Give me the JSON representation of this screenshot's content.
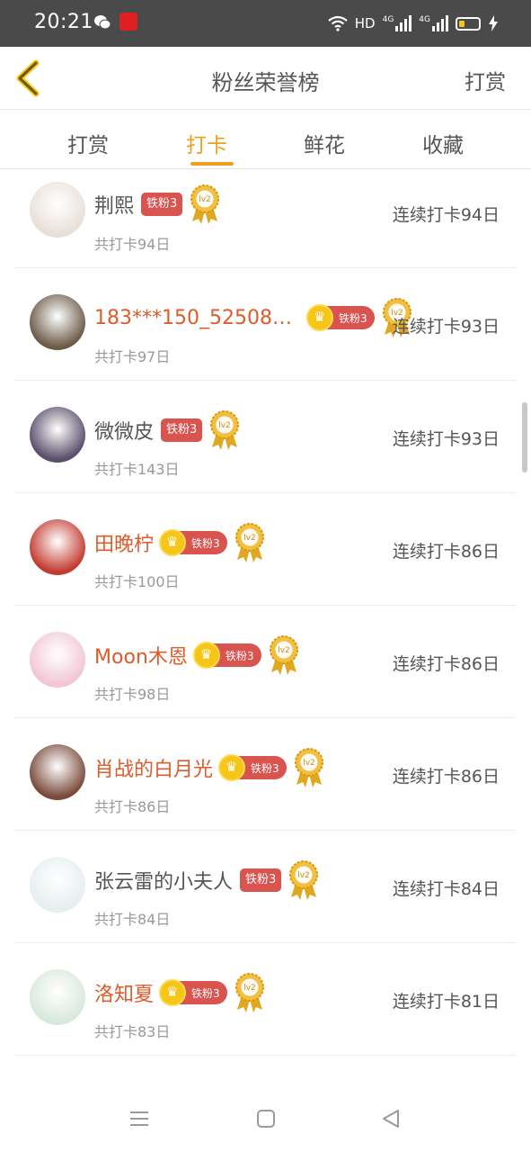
{
  "status_bar": {
    "time": "20:21",
    "indicators": [
      "wifi-icon",
      "HD",
      "4G",
      "4G",
      "battery-icon",
      "charging-icon"
    ]
  },
  "header": {
    "title": "粉丝荣誉榜",
    "action_label": "打赏"
  },
  "tabs": [
    {
      "label": "打赏",
      "active": false
    },
    {
      "label": "打卡",
      "active": true
    },
    {
      "label": "鲜花",
      "active": false
    },
    {
      "label": "收藏",
      "active": false
    }
  ],
  "fans": [
    {
      "name": "荆熙",
      "vip": false,
      "badge": "铁粉3",
      "level": "lv2",
      "total": "共打卡94日",
      "streak": "连续打卡94日",
      "avatar_color": "#e8e0d8"
    },
    {
      "name": "183***150_525085...",
      "vip": true,
      "badge": "铁粉3",
      "level": "lv2",
      "total": "共打卡97日",
      "streak": "连续打卡93日",
      "avatar_color": "#6b5a48"
    },
    {
      "name": "微微皮",
      "vip": false,
      "badge": "铁粉3",
      "level": "lv2",
      "total": "共打卡143日",
      "streak": "连续打卡93日",
      "avatar_color": "#5a4e6a"
    },
    {
      "name": "田晚柠",
      "vip": true,
      "badge": "铁粉3",
      "level": "lv2",
      "total": "共打卡100日",
      "streak": "连续打卡86日",
      "avatar_color": "#c23a30"
    },
    {
      "name": "Moon木恩",
      "vip": true,
      "badge": "铁粉3",
      "level": "lv2",
      "total": "共打卡98日",
      "streak": "连续打卡86日",
      "avatar_color": "#f2c6d4"
    },
    {
      "name": "肖战的白月光",
      "vip": true,
      "badge": "铁粉3",
      "level": "lv2",
      "total": "共打卡86日",
      "streak": "连续打卡86日",
      "avatar_color": "#7a4a3a"
    },
    {
      "name": "张云雷的小夫人",
      "vip": false,
      "badge": "铁粉3",
      "level": "lv2",
      "total": "共打卡84日",
      "streak": "连续打卡84日",
      "avatar_color": "#e6eef0"
    },
    {
      "name": "洛知夏",
      "vip": true,
      "badge": "铁粉3",
      "level": "lv2",
      "total": "共打卡83日",
      "streak": "连续打卡81日",
      "avatar_color": "#d8e8dc"
    }
  ],
  "nav_bar": {
    "buttons": [
      "menu-icon",
      "home-icon",
      "back-triangle-icon"
    ]
  }
}
